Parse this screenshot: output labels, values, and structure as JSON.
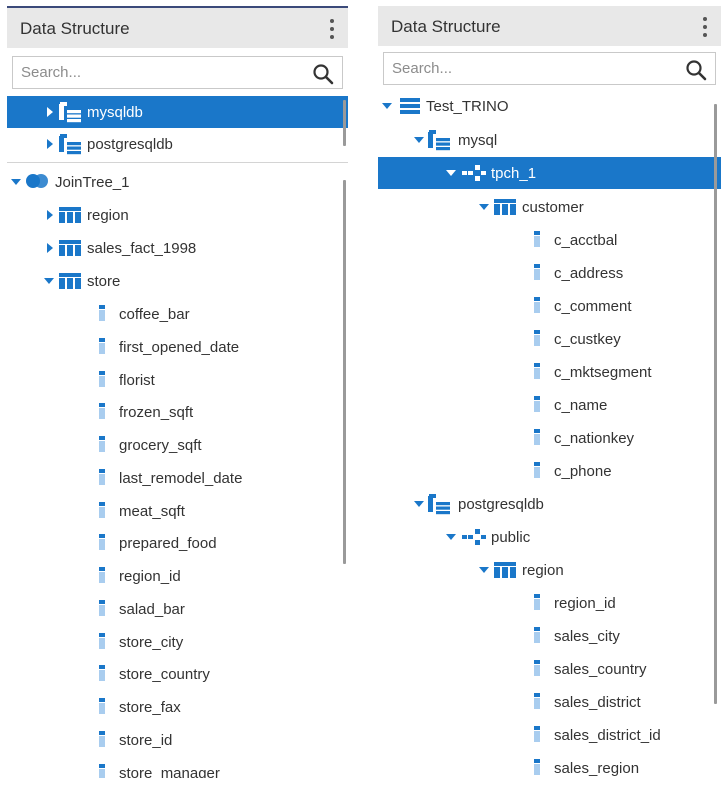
{
  "left": {
    "title": "Data Structure",
    "search_placeholder": "Search...",
    "sources": [
      {
        "label": "mysqldb",
        "selected": true
      },
      {
        "label": "postgresqldb",
        "selected": false
      }
    ],
    "tree": {
      "root": "JoinTree_1",
      "tables": [
        "region",
        "sales_fact_1998",
        "store"
      ],
      "store_columns": [
        "coffee_bar",
        "first_opened_date",
        "florist",
        "frozen_sqft",
        "grocery_sqft",
        "last_remodel_date",
        "meat_sqft",
        "prepared_food",
        "region_id",
        "salad_bar",
        "store_city",
        "store_country",
        "store_fax",
        "store_id",
        "store_manager"
      ]
    }
  },
  "right": {
    "title": "Data Structure",
    "search_placeholder": "Search...",
    "server": "Test_TRINO",
    "mysql": {
      "label": "mysql",
      "schema": "tpch_1",
      "table": "customer",
      "columns": [
        "c_acctbal",
        "c_address",
        "c_comment",
        "c_custkey",
        "c_mktsegment",
        "c_name",
        "c_nationkey",
        "c_phone"
      ]
    },
    "postgres": {
      "label": "postgresqldb",
      "schema": "public",
      "table": "region",
      "columns": [
        "region_id",
        "sales_city",
        "sales_country",
        "sales_district",
        "sales_district_id",
        "sales_region"
      ]
    }
  },
  "colors": {
    "accent": "#1a77c9",
    "header_bg": "#e8e8e8",
    "text": "#333333"
  },
  "icons": {
    "menu": "kebab-menu-icon",
    "search": "search-icon",
    "database": "database-icon",
    "server": "server-icon",
    "schema": "schema-icon",
    "table": "table-icon",
    "column": "column-icon",
    "join": "jointree-icon"
  }
}
